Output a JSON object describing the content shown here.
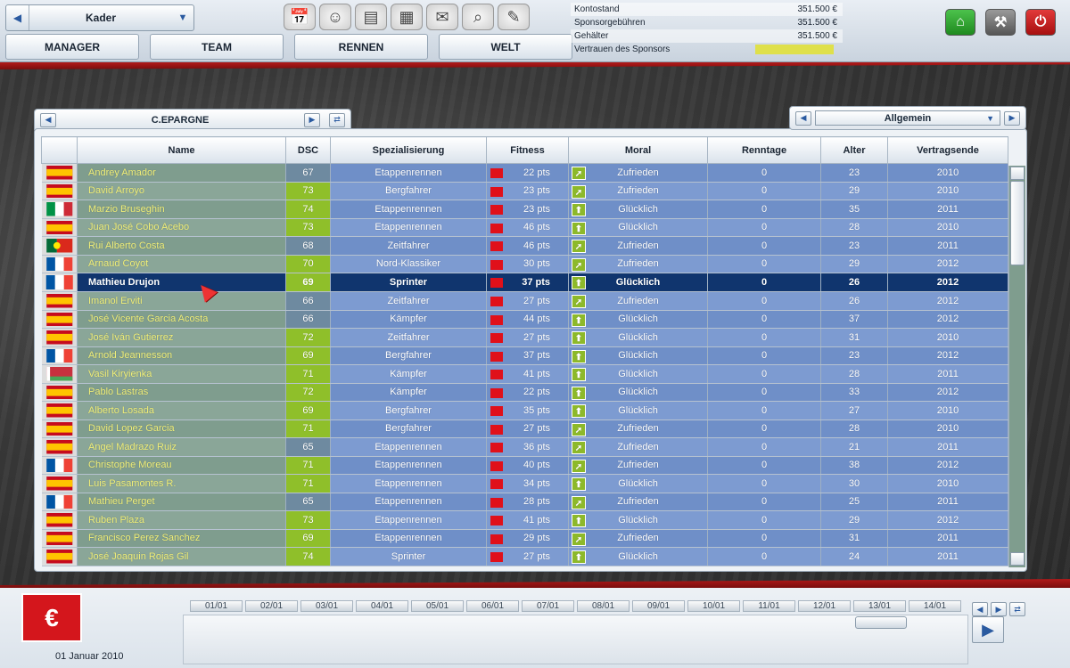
{
  "header": {
    "kader_label": "Kader",
    "nav_tabs": [
      "MANAGER",
      "TEAM",
      "RENNEN",
      "WELT"
    ],
    "tools": [
      "calendar-icon",
      "manager-avatar-icon",
      "money-icon",
      "newspaper-icon",
      "mail-icon",
      "search-icon",
      "notes-icon"
    ],
    "finance": [
      {
        "label": "Kontostand",
        "value": "351.500 €"
      },
      {
        "label": "Sponsorgebühren",
        "value": "351.500 €"
      },
      {
        "label": "Gehälter",
        "value": "351.500 €"
      },
      {
        "label": "Vertrauen des Sponsors",
        "value": ""
      }
    ],
    "right_buttons": [
      "home-icon",
      "tools-icon",
      "exit-icon"
    ],
    "colors": {
      "home": "#2aa02a",
      "tools": "#707070",
      "exit": "#c8161c",
      "trust": "#dfe04a"
    }
  },
  "team": {
    "name": "C.EPARGNE"
  },
  "view": {
    "selected": "Allgemein"
  },
  "table": {
    "headers": [
      "Name",
      "DSC",
      "Spezialisierung",
      "Fitness",
      "Moral",
      "Renntage",
      "Alter",
      "Vertragsende"
    ],
    "selected_index": 6,
    "rows": [
      {
        "flag": "es",
        "name": "Andrey Amador",
        "dsc": "67",
        "spec": "Etappenrennen",
        "fit": "22 pts",
        "mor": "Zufrieden",
        "rt": "0",
        "age": "23",
        "end": "2010"
      },
      {
        "flag": "es",
        "name": "David Arroyo",
        "dsc": "73",
        "spec": "Bergfahrer",
        "fit": "23 pts",
        "mor": "Zufrieden",
        "rt": "0",
        "age": "29",
        "end": "2010"
      },
      {
        "flag": "it",
        "name": "Marzio Bruseghin",
        "dsc": "74",
        "spec": "Etappenrennen",
        "fit": "23 pts",
        "mor": "Glücklich",
        "rt": "0",
        "age": "35",
        "end": "2011"
      },
      {
        "flag": "es",
        "name": "Juan José Cobo Acebo",
        "dsc": "73",
        "spec": "Etappenrennen",
        "fit": "46 pts",
        "mor": "Glücklich",
        "rt": "0",
        "age": "28",
        "end": "2010"
      },
      {
        "flag": "pt",
        "name": "Rui Alberto Costa",
        "dsc": "68",
        "spec": "Zeitfahrer",
        "fit": "46 pts",
        "mor": "Zufrieden",
        "rt": "0",
        "age": "23",
        "end": "2011"
      },
      {
        "flag": "fr",
        "name": "Arnaud Coyot",
        "dsc": "70",
        "spec": "Nord-Klassiker",
        "fit": "30 pts",
        "mor": "Zufrieden",
        "rt": "0",
        "age": "29",
        "end": "2012"
      },
      {
        "flag": "fr",
        "name": "Mathieu Drujon",
        "dsc": "69",
        "spec": "Sprinter",
        "fit": "37 pts",
        "mor": "Glücklich",
        "rt": "0",
        "age": "26",
        "end": "2012"
      },
      {
        "flag": "es",
        "name": "Imanol Erviti",
        "dsc": "66",
        "spec": "Zeitfahrer",
        "fit": "27 pts",
        "mor": "Zufrieden",
        "rt": "0",
        "age": "26",
        "end": "2012"
      },
      {
        "flag": "es",
        "name": "José Vicente Garcia Acosta",
        "dsc": "66",
        "spec": "Kämpfer",
        "fit": "44 pts",
        "mor": "Glücklich",
        "rt": "0",
        "age": "37",
        "end": "2012"
      },
      {
        "flag": "es",
        "name": "José Iván Gutierrez",
        "dsc": "72",
        "spec": "Zeitfahrer",
        "fit": "27 pts",
        "mor": "Glücklich",
        "rt": "0",
        "age": "31",
        "end": "2010"
      },
      {
        "flag": "fr",
        "name": "Arnold Jeannesson",
        "dsc": "69",
        "spec": "Bergfahrer",
        "fit": "37 pts",
        "mor": "Glücklich",
        "rt": "0",
        "age": "23",
        "end": "2012"
      },
      {
        "flag": "by",
        "name": "Vasil Kiryienka",
        "dsc": "71",
        "spec": "Kämpfer",
        "fit": "41 pts",
        "mor": "Glücklich",
        "rt": "0",
        "age": "28",
        "end": "2011"
      },
      {
        "flag": "es",
        "name": "Pablo Lastras",
        "dsc": "72",
        "spec": "Kämpfer",
        "fit": "22 pts",
        "mor": "Glücklich",
        "rt": "0",
        "age": "33",
        "end": "2012"
      },
      {
        "flag": "es",
        "name": "Alberto Losada",
        "dsc": "69",
        "spec": "Bergfahrer",
        "fit": "35 pts",
        "mor": "Glücklich",
        "rt": "0",
        "age": "27",
        "end": "2010"
      },
      {
        "flag": "es",
        "name": "David Lopez Garcia",
        "dsc": "71",
        "spec": "Bergfahrer",
        "fit": "27 pts",
        "mor": "Zufrieden",
        "rt": "0",
        "age": "28",
        "end": "2010"
      },
      {
        "flag": "es",
        "name": "Angel Madrazo Ruiz",
        "dsc": "65",
        "spec": "Etappenrennen",
        "fit": "36 pts",
        "mor": "Zufrieden",
        "rt": "0",
        "age": "21",
        "end": "2011"
      },
      {
        "flag": "fr",
        "name": "Christophe Moreau",
        "dsc": "71",
        "spec": "Etappenrennen",
        "fit": "40 pts",
        "mor": "Zufrieden",
        "rt": "0",
        "age": "38",
        "end": "2012"
      },
      {
        "flag": "es",
        "name": "Luis Pasamontes R.",
        "dsc": "71",
        "spec": "Etappenrennen",
        "fit": "34 pts",
        "mor": "Glücklich",
        "rt": "0",
        "age": "30",
        "end": "2010"
      },
      {
        "flag": "fr",
        "name": "Mathieu Perget",
        "dsc": "65",
        "spec": "Etappenrennen",
        "fit": "28 pts",
        "mor": "Zufrieden",
        "rt": "0",
        "age": "25",
        "end": "2011"
      },
      {
        "flag": "es",
        "name": "Ruben Plaza",
        "dsc": "73",
        "spec": "Etappenrennen",
        "fit": "41 pts",
        "mor": "Glücklich",
        "rt": "0",
        "age": "29",
        "end": "2012"
      },
      {
        "flag": "es",
        "name": "Francisco Perez Sanchez",
        "dsc": "69",
        "spec": "Etappenrennen",
        "fit": "29 pts",
        "mor": "Zufrieden",
        "rt": "0",
        "age": "31",
        "end": "2011"
      },
      {
        "flag": "es",
        "name": "José Joaquin Rojas Gil",
        "dsc": "74",
        "spec": "Sprinter",
        "fit": "27 pts",
        "mor": "Glücklich",
        "rt": "0",
        "age": "24",
        "end": "2011"
      }
    ]
  },
  "footer": {
    "date": "01 Januar 2010",
    "days": [
      "01/01",
      "02/01",
      "03/01",
      "04/01",
      "05/01",
      "06/01",
      "07/01",
      "08/01",
      "09/01",
      "10/01",
      "11/01",
      "12/01",
      "13/01",
      "14/01"
    ]
  }
}
